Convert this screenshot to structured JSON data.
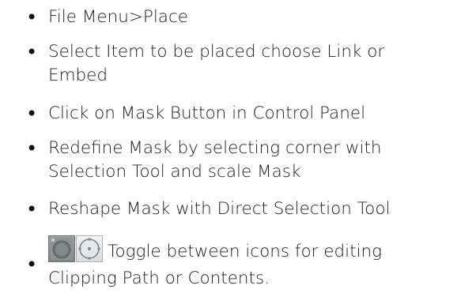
{
  "bullet_char": "•",
  "items": [
    {
      "lines": [
        "File Menu>Place"
      ]
    },
    {
      "lines": [
        "Select Item to be placed choose Link or",
        "Embed"
      ]
    },
    {
      "lines": [
        "Click on Mask Button in Control Panel"
      ]
    },
    {
      "lines": [
        "Redefine Mask by selecting corner with",
        "Selection Tool and scale Mask"
      ]
    },
    {
      "lines": [
        "Reshape Mask with Direct Selection Tool"
      ]
    },
    {
      "lines": [
        "Toggle between icons for editing",
        "Clipping Path or Contents."
      ]
    }
  ],
  "toggle_icons": [
    {
      "icon": "content-grabber-icon"
    },
    {
      "icon": "clipping-path-icon"
    }
  ]
}
